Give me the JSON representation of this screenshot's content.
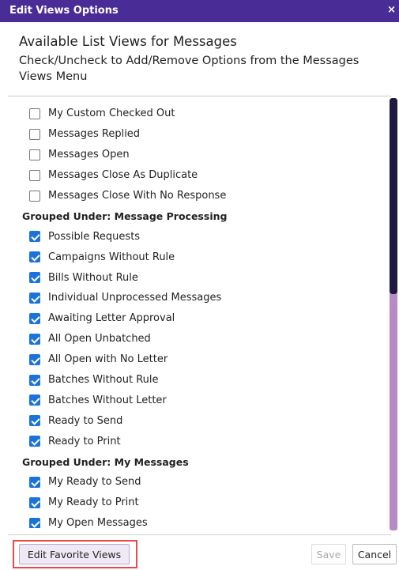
{
  "dialog": {
    "title": "Edit Views Options",
    "close_label": "×"
  },
  "header": {
    "heading": "Available List Views for Messages",
    "description": "Check/Uncheck to Add/Remove Options from the Messages Views Menu"
  },
  "list": [
    {
      "kind": "item",
      "label": "My Custom Checked Out",
      "checked": false
    },
    {
      "kind": "item",
      "label": "Messages Replied",
      "checked": false
    },
    {
      "kind": "item",
      "label": "Messages Open",
      "checked": false
    },
    {
      "kind": "item",
      "label": "Messages Close As Duplicate",
      "checked": false
    },
    {
      "kind": "item",
      "label": "Messages Close With No Response",
      "checked": false
    },
    {
      "kind": "group",
      "label": "Grouped Under: Message Processing"
    },
    {
      "kind": "item",
      "label": "Possible Requests",
      "checked": true
    },
    {
      "kind": "item",
      "label": "Campaigns Without Rule",
      "checked": true
    },
    {
      "kind": "item",
      "label": "Bills Without Rule",
      "checked": true
    },
    {
      "kind": "item",
      "label": "Individual Unprocessed Messages",
      "checked": true
    },
    {
      "kind": "item",
      "label": "Awaiting Letter Approval",
      "checked": true
    },
    {
      "kind": "item",
      "label": "All Open Unbatched",
      "checked": true
    },
    {
      "kind": "item",
      "label": "All Open with No Letter",
      "checked": true
    },
    {
      "kind": "item",
      "label": "Batches Without Rule",
      "checked": true
    },
    {
      "kind": "item",
      "label": "Batches Without Letter",
      "checked": true
    },
    {
      "kind": "item",
      "label": "Ready to Send",
      "checked": true
    },
    {
      "kind": "item",
      "label": "Ready to Print",
      "checked": true
    },
    {
      "kind": "group",
      "label": "Grouped Under: My Messages"
    },
    {
      "kind": "item",
      "label": "My Ready to Send",
      "checked": true
    },
    {
      "kind": "item",
      "label": "My Ready to Print",
      "checked": true
    },
    {
      "kind": "item",
      "label": "My Open Messages",
      "checked": true
    }
  ],
  "footer": {
    "favorite_label": "Edit Favorite Views",
    "save_label": "Save",
    "cancel_label": "Cancel"
  },
  "colors": {
    "titlebar": "#4a2c96",
    "checkbox_checked": "#1a73d9",
    "highlight_outline": "#e84a4a",
    "scrollbar_track": "#b78bc6",
    "scrollbar_thumb": "#1d1940"
  }
}
